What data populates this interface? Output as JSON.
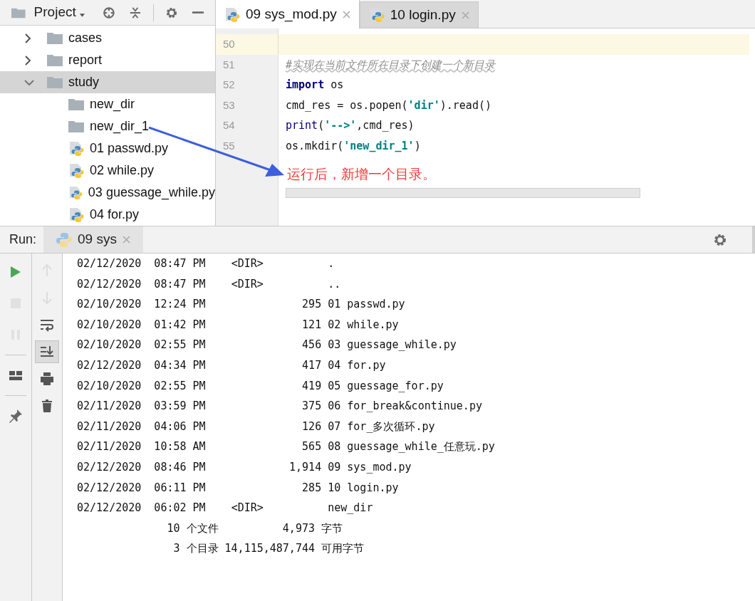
{
  "project_panel": {
    "title": "Project",
    "tree": [
      {
        "label": "cases",
        "kind": "folder",
        "expanded": false,
        "selected": false
      },
      {
        "label": "report",
        "kind": "folder",
        "expanded": false,
        "selected": false
      },
      {
        "label": "study",
        "kind": "folder",
        "expanded": true,
        "selected": true,
        "children": [
          {
            "label": "new_dir",
            "kind": "folder"
          },
          {
            "label": "new_dir_1",
            "kind": "folder"
          },
          {
            "label": "01 passwd.py",
            "kind": "python"
          },
          {
            "label": "02 while.py",
            "kind": "python"
          },
          {
            "label": "03 guessage_while.py",
            "kind": "python"
          },
          {
            "label": "04 for.py",
            "kind": "python"
          }
        ]
      }
    ]
  },
  "editor": {
    "tabs": [
      {
        "label": "09 sys_mod.py",
        "selected": true
      },
      {
        "label": "10 login.py",
        "selected": false
      }
    ],
    "lines": [
      {
        "number": "50",
        "current": true
      },
      {
        "number": "51",
        "current": false,
        "tokens": [
          {
            "kind": "comment",
            "text": "#实现在当前文件所在目录下创建一个新目录"
          }
        ]
      },
      {
        "number": "52",
        "current": false,
        "tokens": [
          {
            "kind": "keyword",
            "text": "import"
          },
          {
            "kind": "plain",
            "text": " os"
          }
        ]
      },
      {
        "number": "53",
        "current": false,
        "tokens": [
          {
            "kind": "plain",
            "text": "cmd_res = os.popen("
          },
          {
            "kind": "string",
            "text": "'dir'"
          },
          {
            "kind": "plain",
            "text": ").read()"
          }
        ]
      },
      {
        "number": "54",
        "current": false,
        "tokens": [
          {
            "kind": "builtin",
            "text": "print"
          },
          {
            "kind": "plain",
            "text": "("
          },
          {
            "kind": "string",
            "text": "'-->'"
          },
          {
            "kind": "plain",
            "text": ",cmd_res)"
          }
        ]
      },
      {
        "number": "55",
        "current": false,
        "tokens": [
          {
            "kind": "plain",
            "text": "os.mkdir("
          },
          {
            "kind": "string",
            "text": "'new_dir_1'"
          },
          {
            "kind": "plain",
            "text": ")"
          }
        ]
      }
    ],
    "annotation": "运行后，新增一个目录。"
  },
  "run_panel": {
    "label": "Run:",
    "tab": "09 sys",
    "tools_left": [
      {
        "kind": "run",
        "disabled": false
      },
      {
        "kind": "stop",
        "disabled": true
      },
      {
        "kind": "pause",
        "disabled": true
      },
      {
        "kind": "layout",
        "disabled": false
      },
      {
        "kind": "pin",
        "disabled": false
      }
    ],
    "tools_right": [
      {
        "kind": "up",
        "disabled": true,
        "selected": false
      },
      {
        "kind": "down",
        "disabled": true,
        "selected": false
      },
      {
        "kind": "wrap",
        "disabled": false,
        "selected": false
      },
      {
        "kind": "scroll-end",
        "disabled": false,
        "selected": true
      },
      {
        "kind": "print",
        "disabled": false,
        "selected": false
      },
      {
        "kind": "delete",
        "disabled": false,
        "selected": false
      }
    ],
    "output": [
      "02/12/2020  08:47 PM    <DIR>          .",
      "02/12/2020  08:47 PM    <DIR>          ..",
      "02/10/2020  12:24 PM               295 01 passwd.py",
      "02/10/2020  01:42 PM               121 02 while.py",
      "02/10/2020  02:55 PM               456 03 guessage_while.py",
      "02/12/2020  04:34 PM               417 04 for.py",
      "02/10/2020  02:55 PM               419 05 guessage_for.py",
      "02/11/2020  03:59 PM               375 06 for_break&continue.py",
      "02/11/2020  04:06 PM               126 07 for_多次循环.py",
      "02/11/2020  10:58 AM               565 08 guessage_while_任意玩.py",
      "02/12/2020  08:46 PM             1,914 09 sys_mod.py",
      "02/12/2020  06:11 PM               285 10 login.py",
      "02/12/2020  06:02 PM    <DIR>          new_dir",
      "              10 个文件          4,973 字节",
      "               3 个目录 14,115,487,744 可用字节"
    ]
  }
}
